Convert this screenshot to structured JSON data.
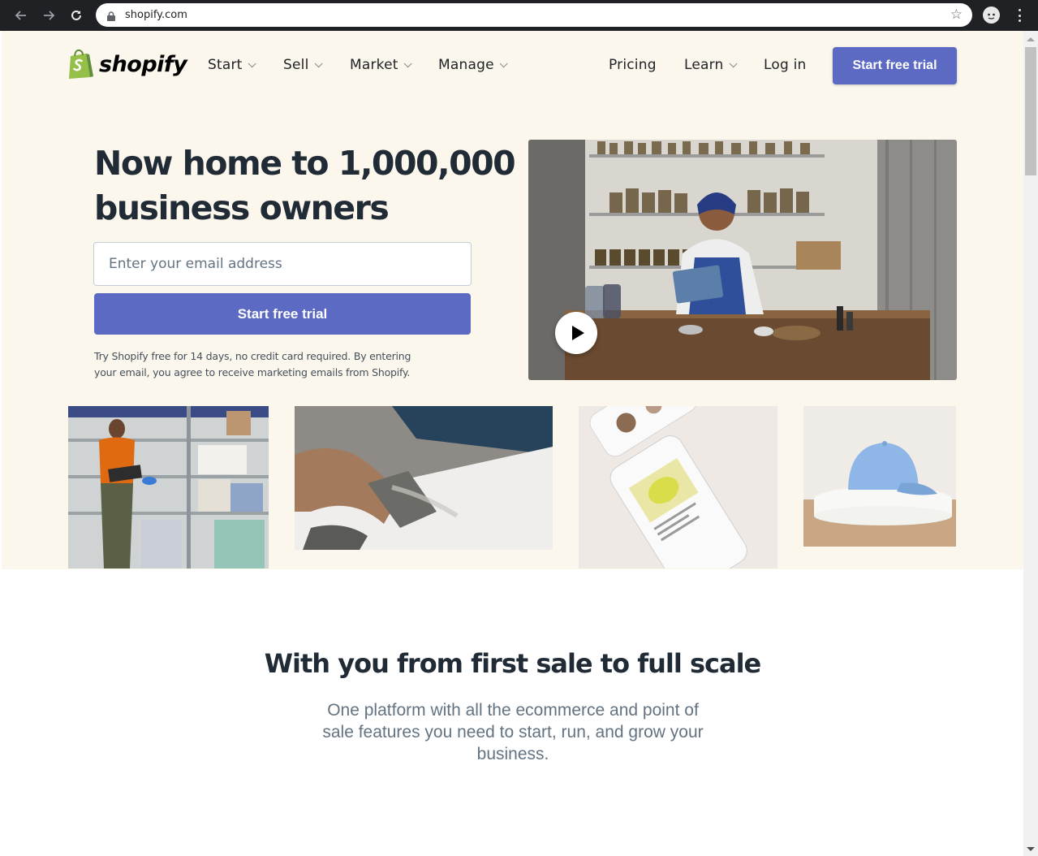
{
  "browser": {
    "url": "shopify.com",
    "back_icon": "back-arrow-icon",
    "forward_icon": "forward-arrow-icon",
    "reload_icon": "reload-icon"
  },
  "header": {
    "logo_text": "shopify",
    "nav": [
      {
        "label": "Start",
        "has_dropdown": true
      },
      {
        "label": "Sell",
        "has_dropdown": true
      },
      {
        "label": "Market",
        "has_dropdown": true
      },
      {
        "label": "Manage",
        "has_dropdown": true
      }
    ],
    "pricing": "Pricing",
    "learn": "Learn",
    "login": "Log in",
    "cta": "Start free trial"
  },
  "hero": {
    "headline_line1": "Now home to 1,000,000",
    "headline_line2": "business owners",
    "email_placeholder": "Enter your email address",
    "cta": "Start free trial",
    "disclaimer": "Try Shopify free for 14 days, no credit card required. By entering your email, you agree to receive marketing emails from Shopify."
  },
  "section2": {
    "title": "With you from first sale to full scale",
    "subtitle": "One platform with all the ecommerce and point of sale features you need to start, run, and grow your business."
  },
  "colors": {
    "brand_purple": "#5c6ac4",
    "hero_bg": "#fbf7ed",
    "shopify_green": "#95bf47",
    "text_dark": "#212b36"
  }
}
